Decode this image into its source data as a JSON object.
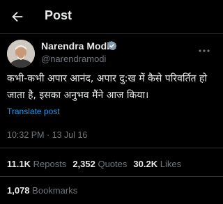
{
  "header": {
    "title": "Post",
    "back_icon": "arrow-left-icon"
  },
  "post": {
    "author_name": "Narendra Modi",
    "author_handle": "@narendramodi",
    "verified_icon": "verified-badge-icon",
    "more_icon": "more-horizontal-icon",
    "text": "कभी-कभी अपार आनंद, अपार दु:ख में कैसे परिवर्तित हो जाता है, इसका अनुभव मैंने आज किया।",
    "translate_label": "Translate post",
    "timestamp": "10:32 PM · 13 Jul 16"
  },
  "stats": {
    "reposts_count": "11.1K",
    "reposts_label": "Reposts",
    "quotes_count": "2,352",
    "quotes_label": "Quotes",
    "likes_count": "30.2K",
    "likes_label": "Likes",
    "bookmarks_count": "1,078",
    "bookmarks_label": "Bookmarks"
  },
  "colors": {
    "background": "#000000",
    "text_primary": "#e7e9ea",
    "text_secondary": "#71767b",
    "accent": "#1d9bf0",
    "divider": "#2f3336"
  }
}
